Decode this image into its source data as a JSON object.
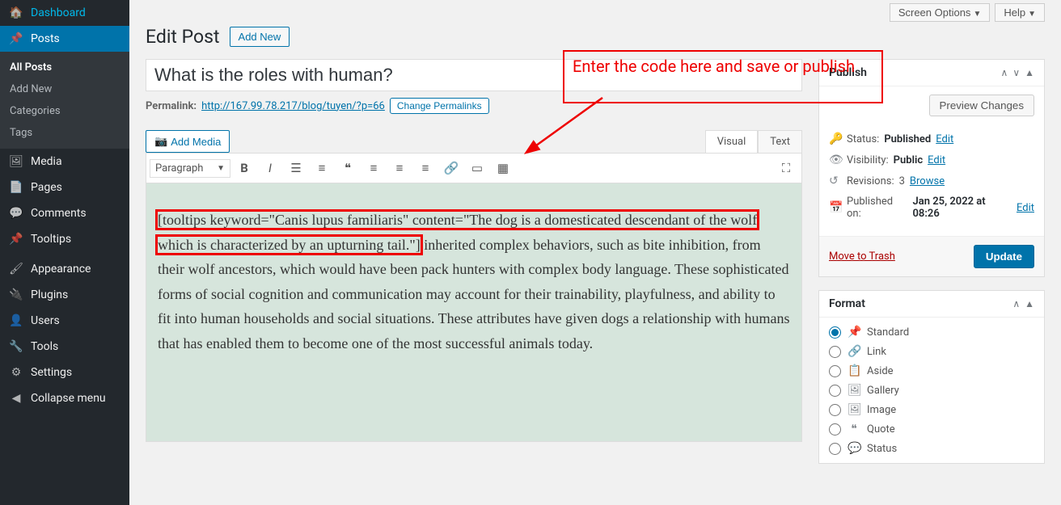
{
  "top": {
    "screen_options": "Screen Options",
    "help": "Help"
  },
  "sidebar": {
    "items": [
      {
        "label": "Dashboard",
        "icon": "🏠"
      },
      {
        "label": "Posts",
        "icon": "📌"
      },
      {
        "label": "Media",
        "icon": "🖼"
      },
      {
        "label": "Pages",
        "icon": "📄"
      },
      {
        "label": "Comments",
        "icon": "💬"
      },
      {
        "label": "Tooltips",
        "icon": "📌"
      },
      {
        "label": "Appearance",
        "icon": "🖌"
      },
      {
        "label": "Plugins",
        "icon": "🔌"
      },
      {
        "label": "Users",
        "icon": "👤"
      },
      {
        "label": "Tools",
        "icon": "🔧"
      },
      {
        "label": "Settings",
        "icon": "⚙"
      }
    ],
    "sub_posts": [
      {
        "label": "All Posts"
      },
      {
        "label": "Add New"
      },
      {
        "label": "Categories"
      },
      {
        "label": "Tags"
      }
    ],
    "collapse": "Collapse menu"
  },
  "header": {
    "page_title": "Edit Post",
    "add_new": "Add New"
  },
  "post": {
    "title_value": "What is the roles with human?",
    "permalink_label": "Permalink:",
    "permalink_url": "http://167.99.78.217/blog/tuyen/?p=66",
    "change_permalinks": "Change Permalinks",
    "add_media": "Add Media",
    "tab_visual": "Visual",
    "tab_text": "Text",
    "format_select": "Paragraph",
    "content_highlight": "[tooltips keyword=\"Canis lupus familiaris\" content=\"The dog is a domesticated descendant of the wolf which is characterized by an upturning tail.\"]",
    "content_rest": " inherited complex behaviors, such as bite inhibition, from their wolf ancestors, which would have been pack hunters with complex body language. These sophisticated forms of social cognition and communication may account for their trainability, playfulness, and ability to fit into human households and social situations. These attributes have given dogs a relationship with humans that has enabled them to become one of the most successful animals today."
  },
  "publish": {
    "box_title": "Publish",
    "preview": "Preview Changes",
    "status_label": "Status:",
    "status_value": "Published",
    "visibility_label": "Visibility:",
    "visibility_value": "Public",
    "revisions_label": "Revisions:",
    "revisions_value": "3",
    "revisions_link": "Browse",
    "published_label": "Published on:",
    "published_value": "Jan 25, 2022 at 08:26",
    "edit_link": "Edit",
    "trash": "Move to Trash",
    "update": "Update"
  },
  "format": {
    "box_title": "Format",
    "options": [
      {
        "label": "Standard",
        "icon": "📌",
        "checked": true
      },
      {
        "label": "Link",
        "icon": "🔗",
        "checked": false
      },
      {
        "label": "Aside",
        "icon": "📋",
        "checked": false
      },
      {
        "label": "Gallery",
        "icon": "🖼",
        "checked": false
      },
      {
        "label": "Image",
        "icon": "🖼",
        "checked": false
      },
      {
        "label": "Quote",
        "icon": "❝",
        "checked": false
      },
      {
        "label": "Status",
        "icon": "💬",
        "checked": false
      }
    ]
  },
  "annotation": {
    "text": "Enter the code here and save or publish"
  }
}
